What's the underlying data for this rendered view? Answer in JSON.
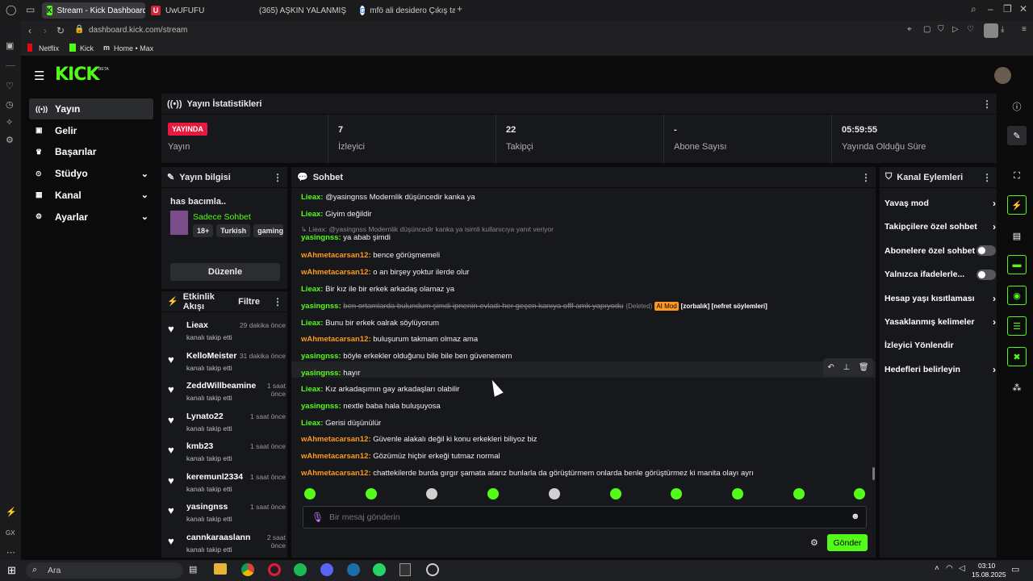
{
  "browser": {
    "tabs": [
      {
        "title": "Stream - Kick Dashboard",
        "fav": "K",
        "active": true
      },
      {
        "title": "UwUFUFU",
        "fav": "U"
      },
      {
        "title": "(365) AŞKIN YALANMIŞ",
        "fav": "yt"
      },
      {
        "title": "mfö ali desidero Çıkış tarı",
        "fav": "G"
      }
    ],
    "url": "dashboard.kick.com/stream",
    "bookmarks": [
      "Netflix",
      "Kick",
      "Home • Max"
    ]
  },
  "brand": {
    "logo": "KICK",
    "beta": "BETA"
  },
  "nav": [
    {
      "label": "Yayın",
      "icon": "broadcast-icon",
      "selected": true
    },
    {
      "label": "Gelir",
      "icon": "wallet-icon"
    },
    {
      "label": "Başarılar",
      "icon": "trophy-icon"
    },
    {
      "label": "Stüdyo",
      "icon": "studio-icon",
      "chev": true
    },
    {
      "label": "Kanal",
      "icon": "channel-icon",
      "chev": true
    },
    {
      "label": "Ayarlar",
      "icon": "gear-icon",
      "chev": true
    }
  ],
  "stats": {
    "title": "Yayın İstatistikleri",
    "live_badge": "YAYINDA",
    "items": [
      {
        "value": "",
        "label": "Yayın"
      },
      {
        "value": "7",
        "label": "İzleyici"
      },
      {
        "value": "22",
        "label": "Takipçi"
      },
      {
        "value": "-",
        "label": "Abone Sayısı"
      },
      {
        "value": "05:59:55",
        "label": "Yayında Olduğu Süre"
      }
    ]
  },
  "stream_info": {
    "title": "Yayın bilgisi",
    "stream_title": "has bacımla..",
    "category": "Sadece Sohbet",
    "tags": [
      "18+",
      "Turkish",
      "gaming"
    ],
    "edit": "Düzenle"
  },
  "activity": {
    "title": "Etkinlik Akışı",
    "filter": "Filtre",
    "items": [
      {
        "name": "Lieax",
        "time": "29 dakika önce",
        "sub": "kanalı takip etti"
      },
      {
        "name": "KelloMeister",
        "time": "31 dakika önce",
        "sub": "kanalı takip etti"
      },
      {
        "name": "ZeddWillbeamine",
        "time": "1 saat önce",
        "sub": "kanalı takip etti"
      },
      {
        "name": "Lynato22",
        "time": "1 saat önce",
        "sub": "kanalı takip etti"
      },
      {
        "name": "kmb23",
        "time": "1 saat önce",
        "sub": "kanalı takip etti"
      },
      {
        "name": "keremunl2334",
        "time": "1 saat önce",
        "sub": "kanalı takip etti"
      },
      {
        "name": "yasingnss",
        "time": "1 saat önce",
        "sub": "kanalı takip etti"
      },
      {
        "name": "cannkaraaslann",
        "time": "2 saat önce",
        "sub": "kanalı takip etti"
      }
    ]
  },
  "chat": {
    "title": "Sohbet",
    "messages": [
      {
        "user": "Lieax",
        "text": "@yasingnss Modernlik düşüncedir kanka ya",
        "color": "green"
      },
      {
        "user": "Lieax",
        "text": "Giyim değildir",
        "color": "green"
      },
      {
        "reply": "Lieax: @yasingnss Modernlik düşüncedir kanka ya isimli kullanıcıya yanıt veriyor"
      },
      {
        "user": "yasingnss",
        "text": "ya abab şimdi",
        "color": "green"
      },
      {
        "user": "wAhmetacarsan12",
        "text": "bence görüşmemeli",
        "color": "orange"
      },
      {
        "user": "wAhmetacarsan12",
        "text": "o an birşey yoktur ilerde olur",
        "color": "orange"
      },
      {
        "user": "Lieax",
        "text": "Bir kız ile bir erkek arkadaş olamaz ya",
        "color": "green"
      },
      {
        "user": "yasingnss",
        "text": "ben ortamlarda bulundum şimdi ipnenin evladı her geçen kanıya offf amk yapıyodu",
        "color": "green",
        "deleted": true,
        "deleted_label": "(Deleted)",
        "mod": "AI Mod",
        "reasons": "[zorbalık] [nefret söylemleri]"
      },
      {
        "user": "Lieax",
        "text": "Bunu bir erkek oalrak söylüyorum",
        "color": "green"
      },
      {
        "user": "wAhmetacarsan12",
        "text": "buluşurum takmam olmaz ama",
        "color": "orange"
      },
      {
        "user": "yasingnss",
        "text": "böyle erkekler olduğunu bile bile ben güvenemem",
        "color": "green"
      },
      {
        "user": "yasingnss",
        "text": "hayır",
        "color": "green",
        "hover": true
      },
      {
        "user": "Lieax",
        "text": "Kız arkadaşımın gay arkadaşları olabilir",
        "color": "green"
      },
      {
        "user": "yasingnss",
        "text": "nextle baba hala buluşuyosa",
        "color": "green"
      },
      {
        "user": "Lieax",
        "text": "Gerisi düşünülür",
        "color": "green"
      },
      {
        "user": "wAhmetacarsan12",
        "text": "Güvenle alakalı değil ki konu erkekleri biliyoz biz",
        "color": "orange"
      },
      {
        "user": "wAhmetacarsan12",
        "text": "Gözümüz hiçbir erkeği tutmaz normal",
        "color": "orange"
      },
      {
        "user": "wAhmetacarsan12",
        "text": "chattekilerde burda gırgır şamata atarız bunlarla da görüştürmem onlarda benle görüştürmez ki manita olayı ayrı",
        "color": "orange"
      }
    ],
    "placeholder": "Bir mesaj gönderin",
    "send": "Gönder"
  },
  "channel_actions": {
    "title": "Kanal Eylemleri",
    "items": [
      {
        "label": "Yavaş mod",
        "type": "chev"
      },
      {
        "label": "Takipçilere özel sohbet",
        "type": "chev"
      },
      {
        "label": "Abonelere özel sohbet",
        "type": "toggle"
      },
      {
        "label": "Yalnızca ifadelerle...",
        "type": "toggle"
      },
      {
        "label": "Hesap yaşı kısıtlaması",
        "type": "chev"
      },
      {
        "label": "Yasaklanmış kelimeler",
        "type": "chev"
      },
      {
        "label": "İzleyici Yönlendir",
        "type": "none"
      },
      {
        "label": "Hedefleri belirleyin",
        "type": "chev"
      }
    ]
  },
  "taskbar": {
    "search": "Ara",
    "time": "03:10",
    "date": "15.08.2025"
  },
  "colors": {
    "accent": "#53fc18",
    "live": "#e8193f",
    "panel": "#17181b",
    "orange_user": "#ff9a1f"
  }
}
